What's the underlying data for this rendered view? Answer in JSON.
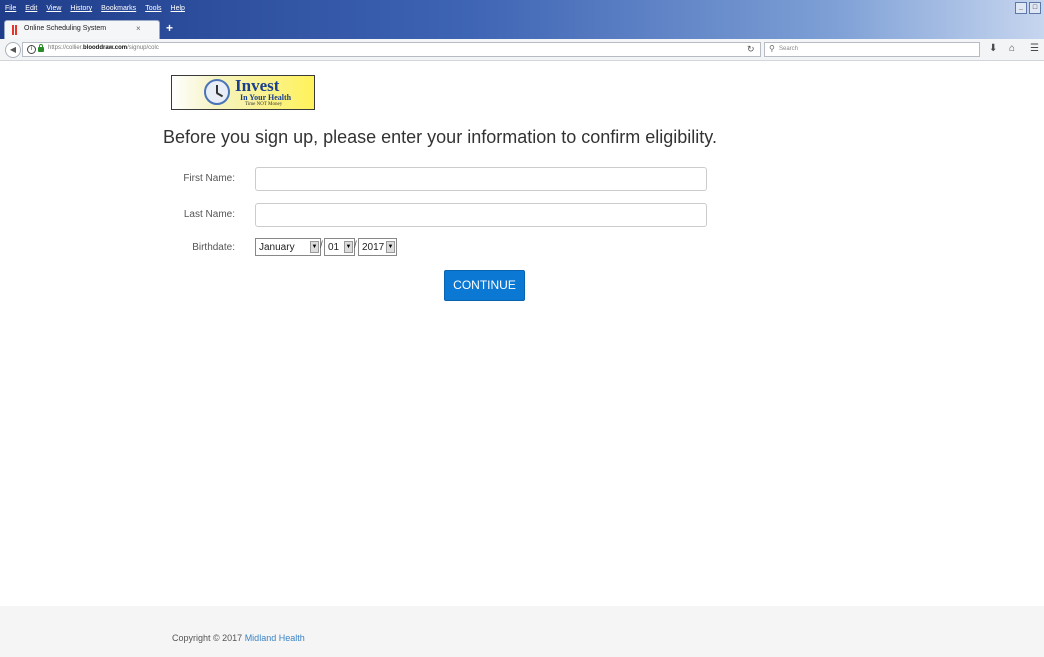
{
  "browser": {
    "menu": [
      "File",
      "Edit",
      "View",
      "History",
      "Bookmarks",
      "Tools",
      "Help"
    ],
    "window_controls": [
      "_",
      "&#9633;"
    ],
    "tab": {
      "title": "Online Scheduling System",
      "close": "×"
    },
    "new_tab": "+",
    "url": {
      "prefix": "https://collier.",
      "domain": "blooddraw.com",
      "path": "/signup/colc"
    },
    "search_placeholder": "Search"
  },
  "logo": {
    "word": "Invest",
    "line2": "In Your Health",
    "tagline": "Time NOT Money"
  },
  "page": {
    "heading": "Before you sign up, please enter your information to confirm eligibility.",
    "form": {
      "first_name_label": "First Name:",
      "first_name_value": "",
      "last_name_label": "Last Name:",
      "last_name_value": "",
      "birthdate_label": "Birthdate:",
      "month": "January",
      "day": "01",
      "year": "2017",
      "separator": "/"
    },
    "continue_label": "CONTINUE"
  },
  "footer": {
    "copyright_prefix": "Copyright © 2017 ",
    "org": "Midland Health"
  },
  "colors": {
    "button": "#0b78d3",
    "link": "#3b83c4",
    "titlebar": "#1f3d8a"
  }
}
